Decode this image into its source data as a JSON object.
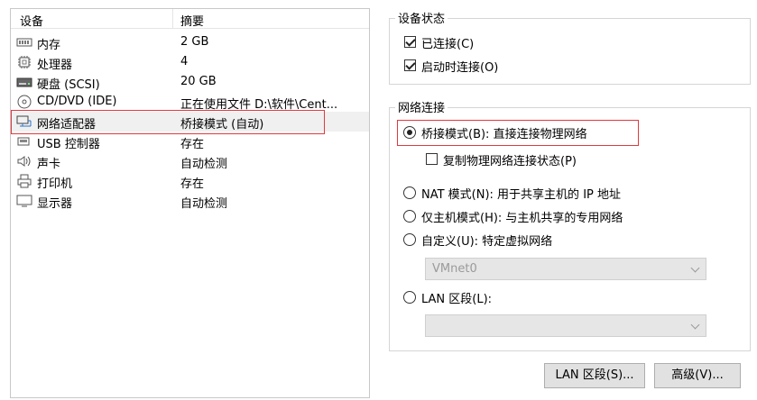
{
  "device_list": {
    "columns": {
      "device": "设备",
      "summary": "摘要"
    },
    "rows": [
      {
        "icon": "memory-icon",
        "name": "内存",
        "summary": "2 GB"
      },
      {
        "icon": "processor-icon",
        "name": "处理器",
        "summary": "4"
      },
      {
        "icon": "hard-disk-icon",
        "name": "硬盘 (SCSI)",
        "summary": "20 GB"
      },
      {
        "icon": "cd-dvd-icon",
        "name": "CD/DVD (IDE)",
        "summary": "正在使用文件 D:\\软件\\Cent..."
      },
      {
        "icon": "network-adapter-icon",
        "name": "网络适配器",
        "summary": "桥接模式 (自动)"
      },
      {
        "icon": "usb-controller-icon",
        "name": "USB 控制器",
        "summary": "存在"
      },
      {
        "icon": "sound-card-icon",
        "name": "声卡",
        "summary": "自动检测"
      },
      {
        "icon": "printer-icon",
        "name": "打印机",
        "summary": "存在"
      },
      {
        "icon": "display-icon",
        "name": "显示器",
        "summary": "自动检测"
      }
    ],
    "selected_index": 4
  },
  "device_status": {
    "title": "设备状态",
    "connected": {
      "label": "已连接(C)",
      "checked": true
    },
    "connect_at_power_on": {
      "label": "启动时连接(O)",
      "checked": true
    }
  },
  "network_connection": {
    "title": "网络连接",
    "bridged": {
      "label": "桥接模式(B): 直接连接物理网络",
      "selected": true
    },
    "replicate_state": {
      "label": "复制物理网络连接状态(P)",
      "checked": false
    },
    "nat": {
      "label": "NAT 模式(N): 用于共享主机的 IP 地址",
      "selected": false
    },
    "host_only": {
      "label": "仅主机模式(H): 与主机共享的专用网络",
      "selected": false
    },
    "custom": {
      "label": "自定义(U): 特定虚拟网络",
      "selected": false
    },
    "custom_select_value": "VMnet0",
    "lan_segment": {
      "label": "LAN 区段(L):",
      "selected": false
    },
    "lan_select_value": ""
  },
  "buttons": {
    "lan_segments": "LAN 区段(S)...",
    "advanced": "高级(V)..."
  },
  "colors": {
    "highlight_border": "#e0393e",
    "selected_row": "#f0f0f0"
  }
}
